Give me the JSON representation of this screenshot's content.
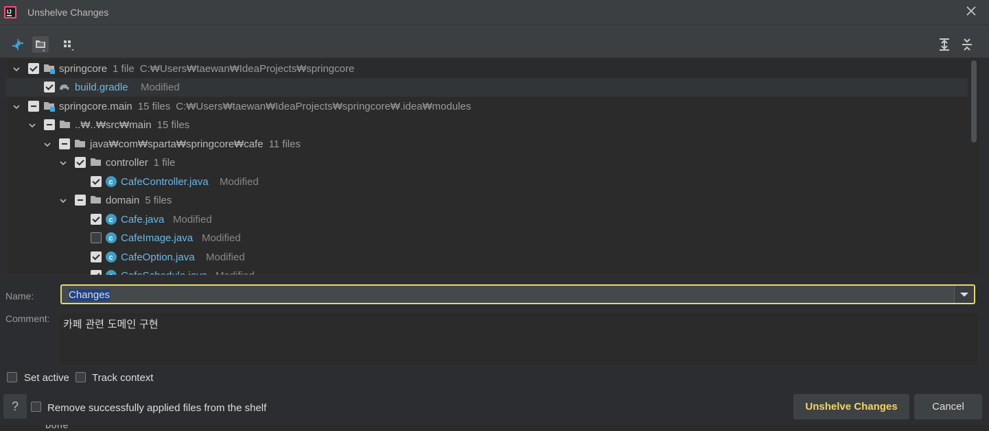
{
  "dialog": {
    "title": "Unshelve Changes"
  },
  "toolbar": {
    "icons": [
      "merge-arrows-icon",
      "group-by-folder-icon",
      "layout-options-icon",
      "expand-all-icon",
      "collapse-all-icon"
    ]
  },
  "tree": {
    "rows": [
      {
        "label": "springcore",
        "count": "1 file",
        "path": "C:₩Users₩taewan₩IdeaProjects₩springcore"
      },
      {
        "label": "build.gradle",
        "status": "Modified"
      },
      {
        "label": "springcore.main",
        "count": "15 files",
        "path": "C:₩Users₩taewan₩IdeaProjects₩springcore₩.idea₩modules"
      },
      {
        "label": "..₩..₩src₩main",
        "count": "15 files"
      },
      {
        "label": "java₩com₩sparta₩springcore₩cafe",
        "count": "11 files"
      },
      {
        "label": "controller",
        "count": "1 file"
      },
      {
        "label": "CafeController.java",
        "status": "Modified"
      },
      {
        "label": "domain",
        "count": "5 files"
      },
      {
        "label": "Cafe.java",
        "status": "Modified"
      },
      {
        "label": "CafeImage.java",
        "status": "Modified"
      },
      {
        "label": "CafeOption.java",
        "status": "Modified"
      },
      {
        "label": "CafeSchedule.java",
        "status": "Modified"
      }
    ]
  },
  "form": {
    "name_label": "Name:",
    "name_value": "Changes",
    "comment_label": "Comment:",
    "comment_value": "카페 관련 도메인 구현"
  },
  "options": {
    "set_active": "Set active",
    "track_context": "Track context",
    "remove_applied": "Remove successfully applied files from the shelf"
  },
  "buttons": {
    "help": "?",
    "unshelve": "Unshelve Changes",
    "cancel": "Cancel"
  },
  "background": {
    "text": "Done"
  },
  "colors": {
    "accent": "#e6d96a",
    "file": "#6bb8e8",
    "primary_text": "#f0d465"
  }
}
